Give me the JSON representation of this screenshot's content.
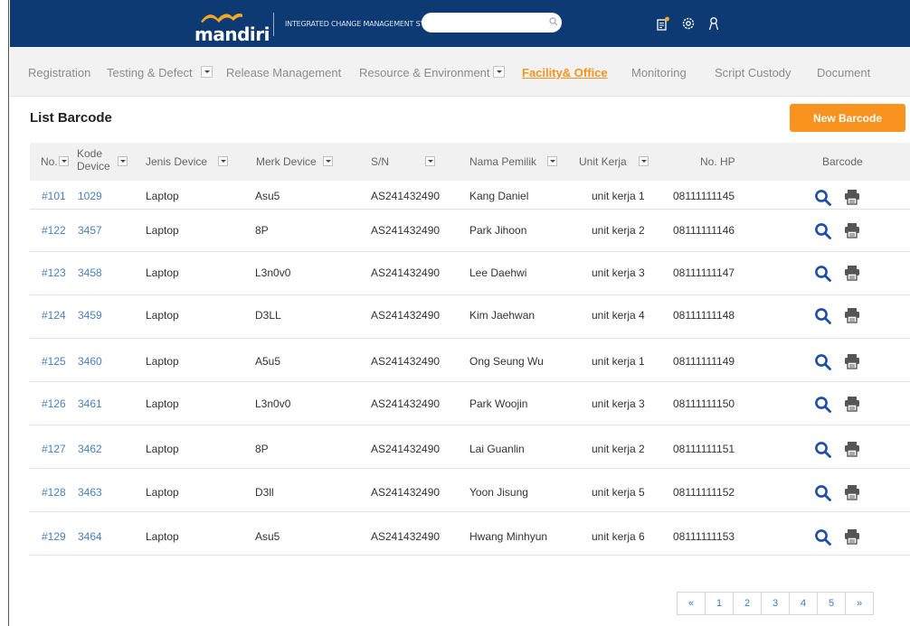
{
  "header": {
    "logo_text": "mandiri",
    "system_name": "INTEGRATED CHANGE MANAGEMENT SYSTEM",
    "search_placeholder": "",
    "accent_color": "#0d3a72"
  },
  "nav": {
    "items": [
      {
        "label": "Registration"
      },
      {
        "label": "Testing & Defect"
      },
      {
        "label": "Release  Management"
      },
      {
        "label": "Resource & Environment"
      },
      {
        "label": "Facility& Office"
      },
      {
        "label": "Monitoring"
      },
      {
        "label": "Script Custody"
      },
      {
        "label": "Document"
      }
    ],
    "active": "Facility& Office",
    "active_color": "#f7931e"
  },
  "page": {
    "title": "List Barcode",
    "new_button": "New Barcode"
  },
  "table": {
    "headers": {
      "no": "No.",
      "kode_line1": "Kode",
      "kode_line2": "Device",
      "jenis": "Jenis Device",
      "merk": "Merk Device",
      "sn": "S/N",
      "nama": "Nama Pemilik",
      "unit": "Unit Kerja",
      "hp": "No. HP",
      "barcode": "Barcode"
    },
    "rows": [
      {
        "no": "#101",
        "kode": "1029",
        "jenis": "Laptop",
        "merk": "Asu5",
        "sn": "AS241432490",
        "nama": "Kang Daniel",
        "unit": "unit kerja 1",
        "hp": "08111111145"
      },
      {
        "no": "#122",
        "kode": "3457",
        "jenis": "Laptop",
        "merk": "8P",
        "sn": "AS241432490",
        "nama": "Park Jihoon",
        "unit": "unit kerja 2",
        "hp": "08111111146"
      },
      {
        "no": "#123",
        "kode": "3458",
        "jenis": "Laptop",
        "merk": "L3n0v0",
        "sn": "AS241432490",
        "nama": "Lee Daehwi",
        "unit": "unit kerja 3",
        "hp": "08111111147"
      },
      {
        "no": "#124",
        "kode": "3459",
        "jenis": "Laptop",
        "merk": "D3LL",
        "sn": "AS241432490",
        "nama": "Kim Jaehwan",
        "unit": "unit kerja 4",
        "hp": "08111111148"
      },
      {
        "no": "#125",
        "kode": "3460",
        "jenis": "Laptop",
        "merk": "A5u5",
        "sn": "AS241432490",
        "nama": "Ong Seung Wu",
        "unit": "unit kerja 1",
        "hp": "08111111149"
      },
      {
        "no": "#126",
        "kode": "3461",
        "jenis": "Laptop",
        "merk": "L3n0v0",
        "sn": "AS241432490",
        "nama": "Park Woojin",
        "unit": "unit kerja 3",
        "hp": "08111111150"
      },
      {
        "no": "#127",
        "kode": "3462",
        "jenis": "Laptop",
        "merk": "8P",
        "sn": "AS241432490",
        "nama": "Lai Guanlin",
        "unit": "unit kerja 2",
        "hp": "08111111151"
      },
      {
        "no": "#128",
        "kode": "3463",
        "jenis": "Laptop",
        "merk": "D3ll",
        "sn": "AS241432490",
        "nama": "Yoon Jisung",
        "unit": "unit kerja 5",
        "hp": "08111111152"
      },
      {
        "no": "#129",
        "kode": "3464",
        "jenis": "Laptop",
        "merk": "Asu5",
        "sn": "AS241432490",
        "nama": "Hwang Minhyun",
        "unit": "unit kerja 6",
        "hp": "08111111153"
      }
    ],
    "row_icons": [
      "search-icon",
      "printer-icon"
    ]
  },
  "pagination": {
    "prev": "«",
    "pages": [
      "1",
      "2",
      "3",
      "4",
      "5"
    ],
    "next": "»"
  }
}
